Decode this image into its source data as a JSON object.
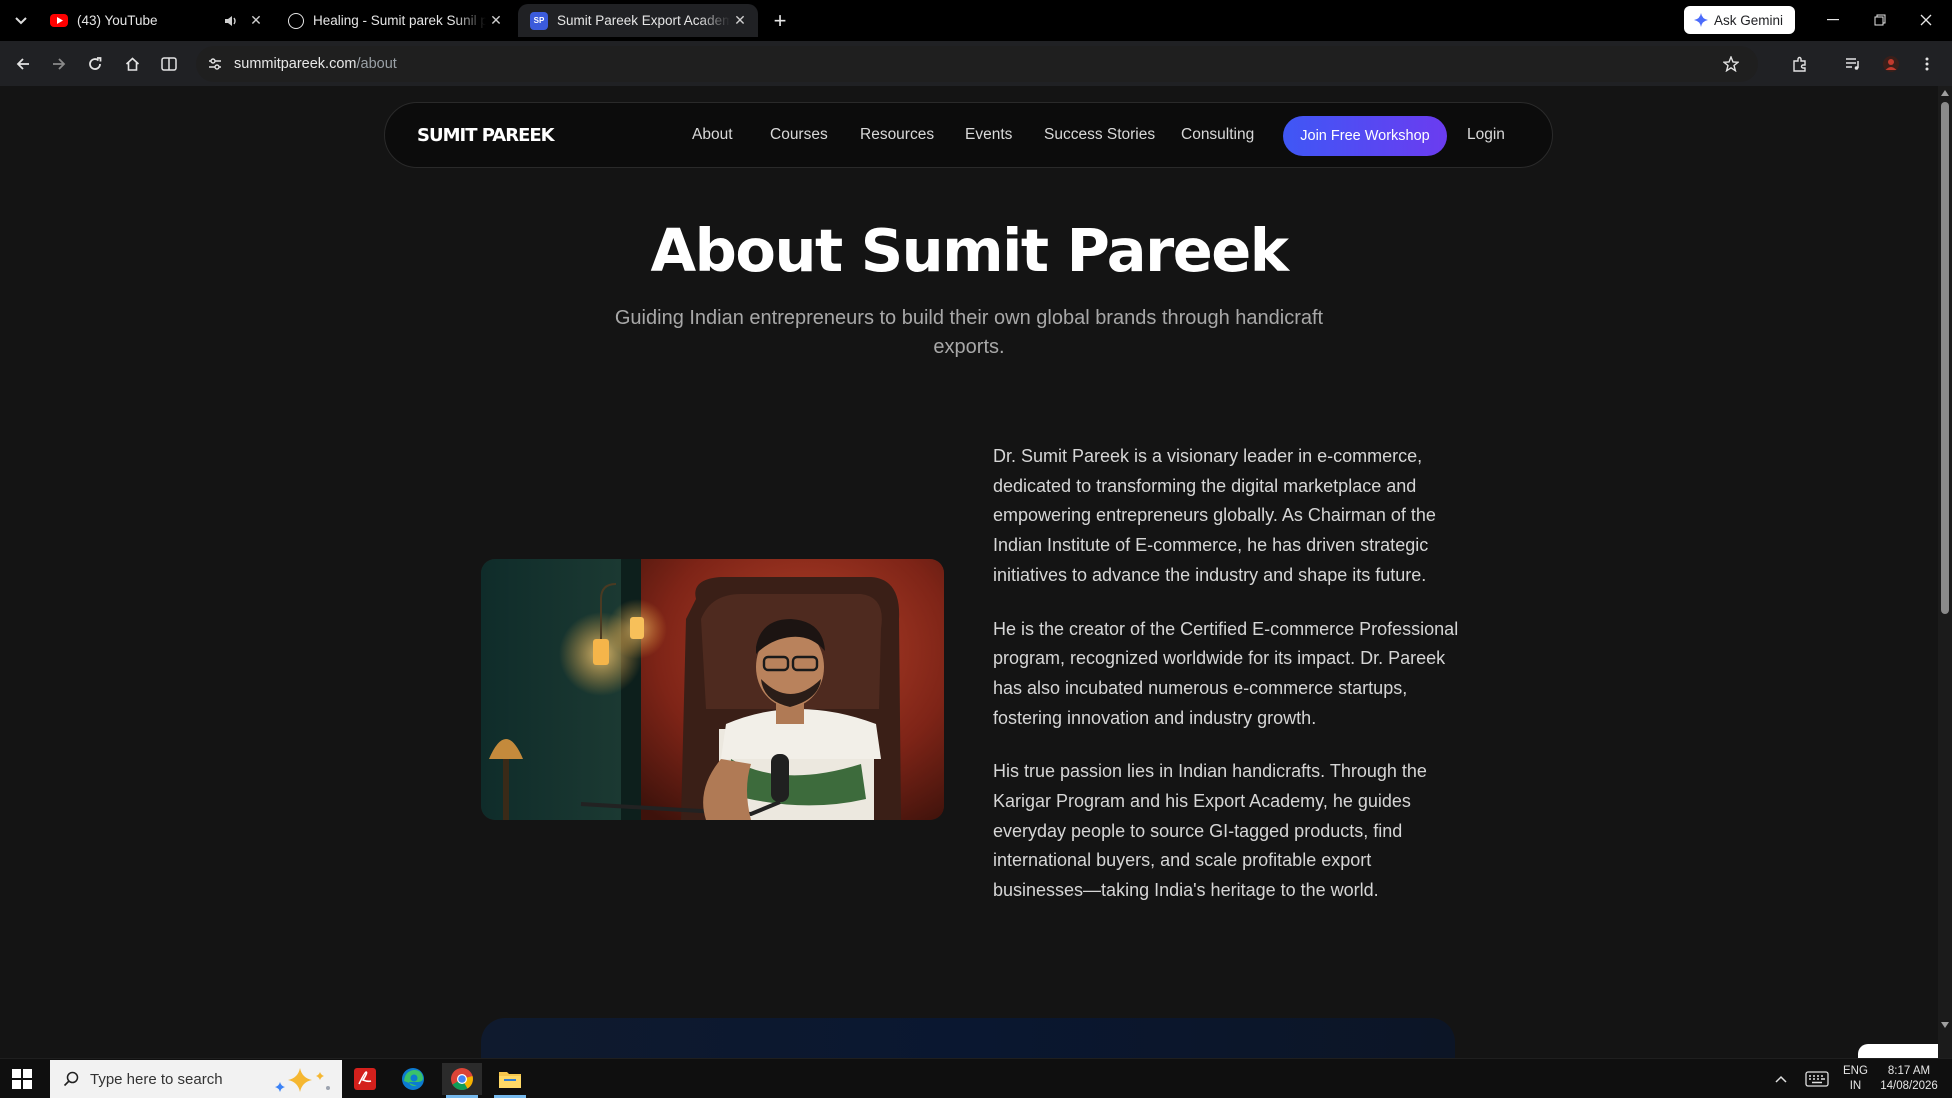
{
  "browser": {
    "tabs": [
      {
        "title": "(43) YouTube",
        "favicon": "youtube-icon",
        "color": "#ff0000",
        "audio": true
      },
      {
        "title": "Healing - Sumit parek Sunil pareek",
        "favicon": "openai-icon",
        "color": "#e6e6e6"
      },
      {
        "title": "Sumit Pareek Export Academy - About",
        "favicon": "sp-favicon",
        "favicon_text": "SP",
        "color": "#3b5bdb",
        "active": true
      }
    ],
    "ask_gemini_label": "Ask Gemini",
    "url_host": "summitpareek.com",
    "url_path": "/about"
  },
  "site": {
    "logo": "SUMIT PAREEK",
    "nav": [
      "About",
      "Courses",
      "Resources",
      "Events",
      "Success Stories",
      "Consulting"
    ],
    "cta_label": "Join Free Workshop",
    "login_label": "Login",
    "title": "About Sumit Pareek",
    "subtitle": "Guiding Indian entrepreneurs to build their own global brands through handicraft exports.",
    "bio": [
      "Dr. Sumit Pareek is a visionary leader in e-commerce, dedicated to transforming the digital marketplace and empowering entrepreneurs globally. As Chairman of the Indian Institute of E-commerce, he has driven strategic initiatives to advance the industry and shape its future.",
      "He is the creator of the Certified E-commerce Professional program, recognized worldwide for its impact. Dr. Pareek has also incubated numerous e-commerce startups, fostering innovation and industry growth.",
      "His true passion lies in Indian handicrafts. Through the Karigar Program and his Export Academy, he guides everyday people to source GI-tagged products, find international buyers, and scale profitable export businesses—taking India's heritage to the world."
    ],
    "accent_gradient": [
      "#3f57f5",
      "#6b3cf0"
    ]
  },
  "taskbar": {
    "search_placeholder": "Type here to search",
    "apps": [
      "acrobat-icon",
      "edge-icon",
      "chrome-icon",
      "file-explorer-icon"
    ],
    "lang_line1": "ENG",
    "lang_line2": "IN",
    "time": "8:17 AM",
    "date": "14/08/2026"
  }
}
